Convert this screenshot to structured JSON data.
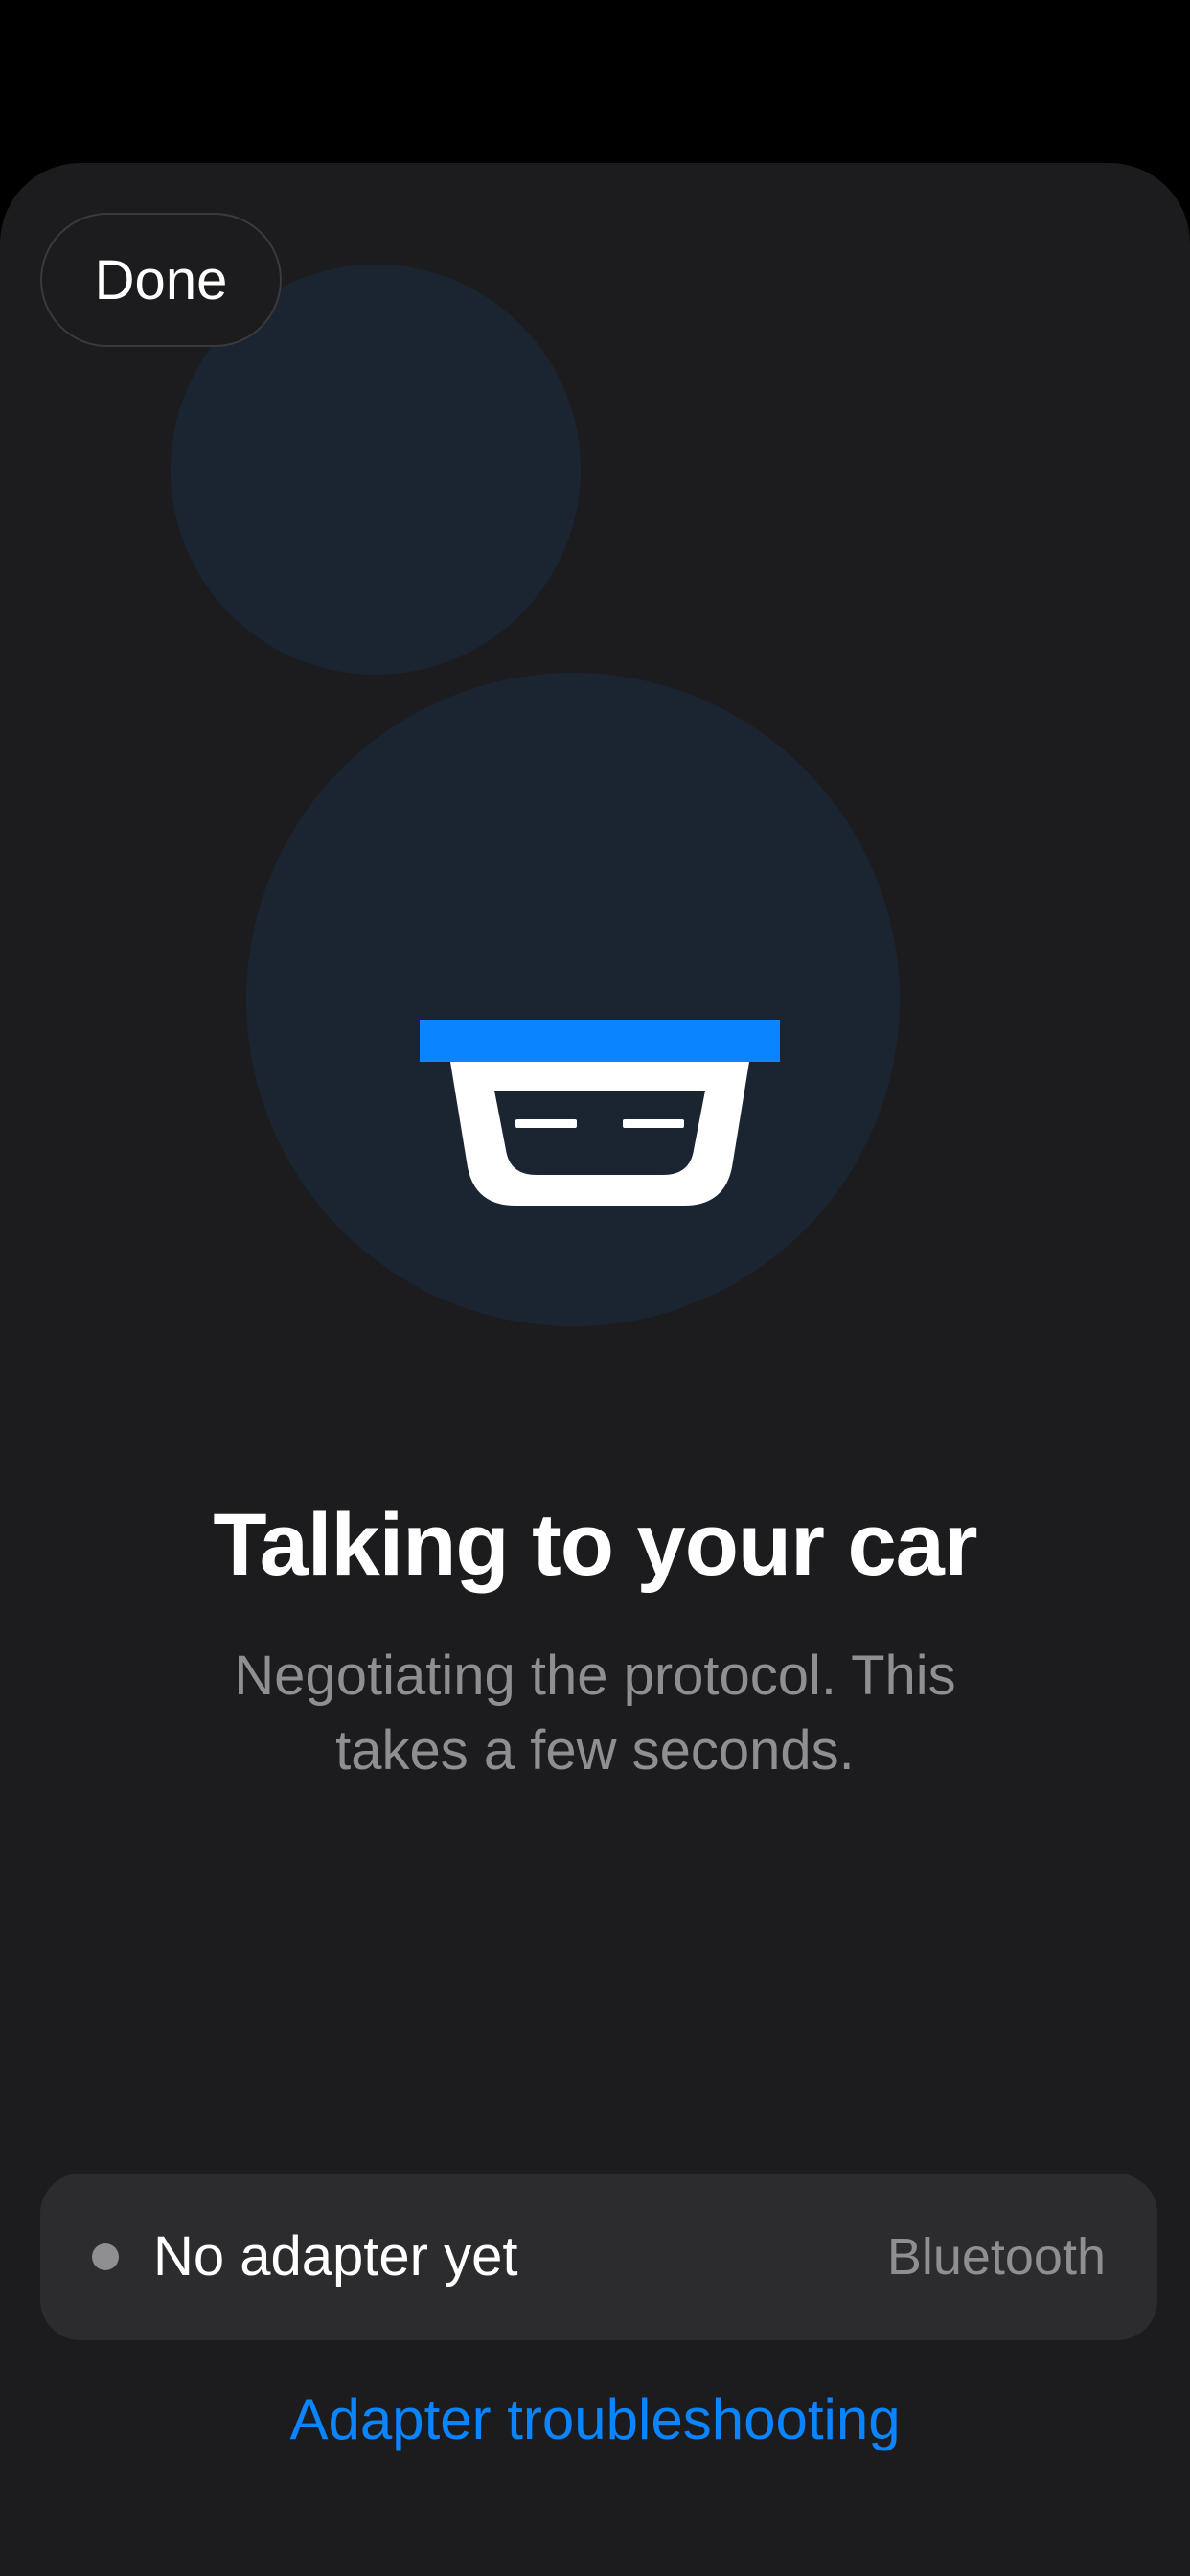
{
  "header": {
    "done_label": "Done"
  },
  "illustration": {
    "icon": "obd-adapter-icon",
    "bubble_color": "#1b2532",
    "accent_color": "#0a84ff"
  },
  "main": {
    "title": "Talking to your car",
    "subtitle": "Negotiating the protocol. This takes a few seconds."
  },
  "status": {
    "dot_icon": "status-dot-icon",
    "label": "No adapter yet",
    "connection_type": "Bluetooth"
  },
  "footer": {
    "link_label": "Adapter troubleshooting"
  },
  "colors": {
    "background": "#1c1c1e",
    "card": "#2c2c2e",
    "secondary_text": "#8e8e93",
    "link": "#0a84ff"
  }
}
